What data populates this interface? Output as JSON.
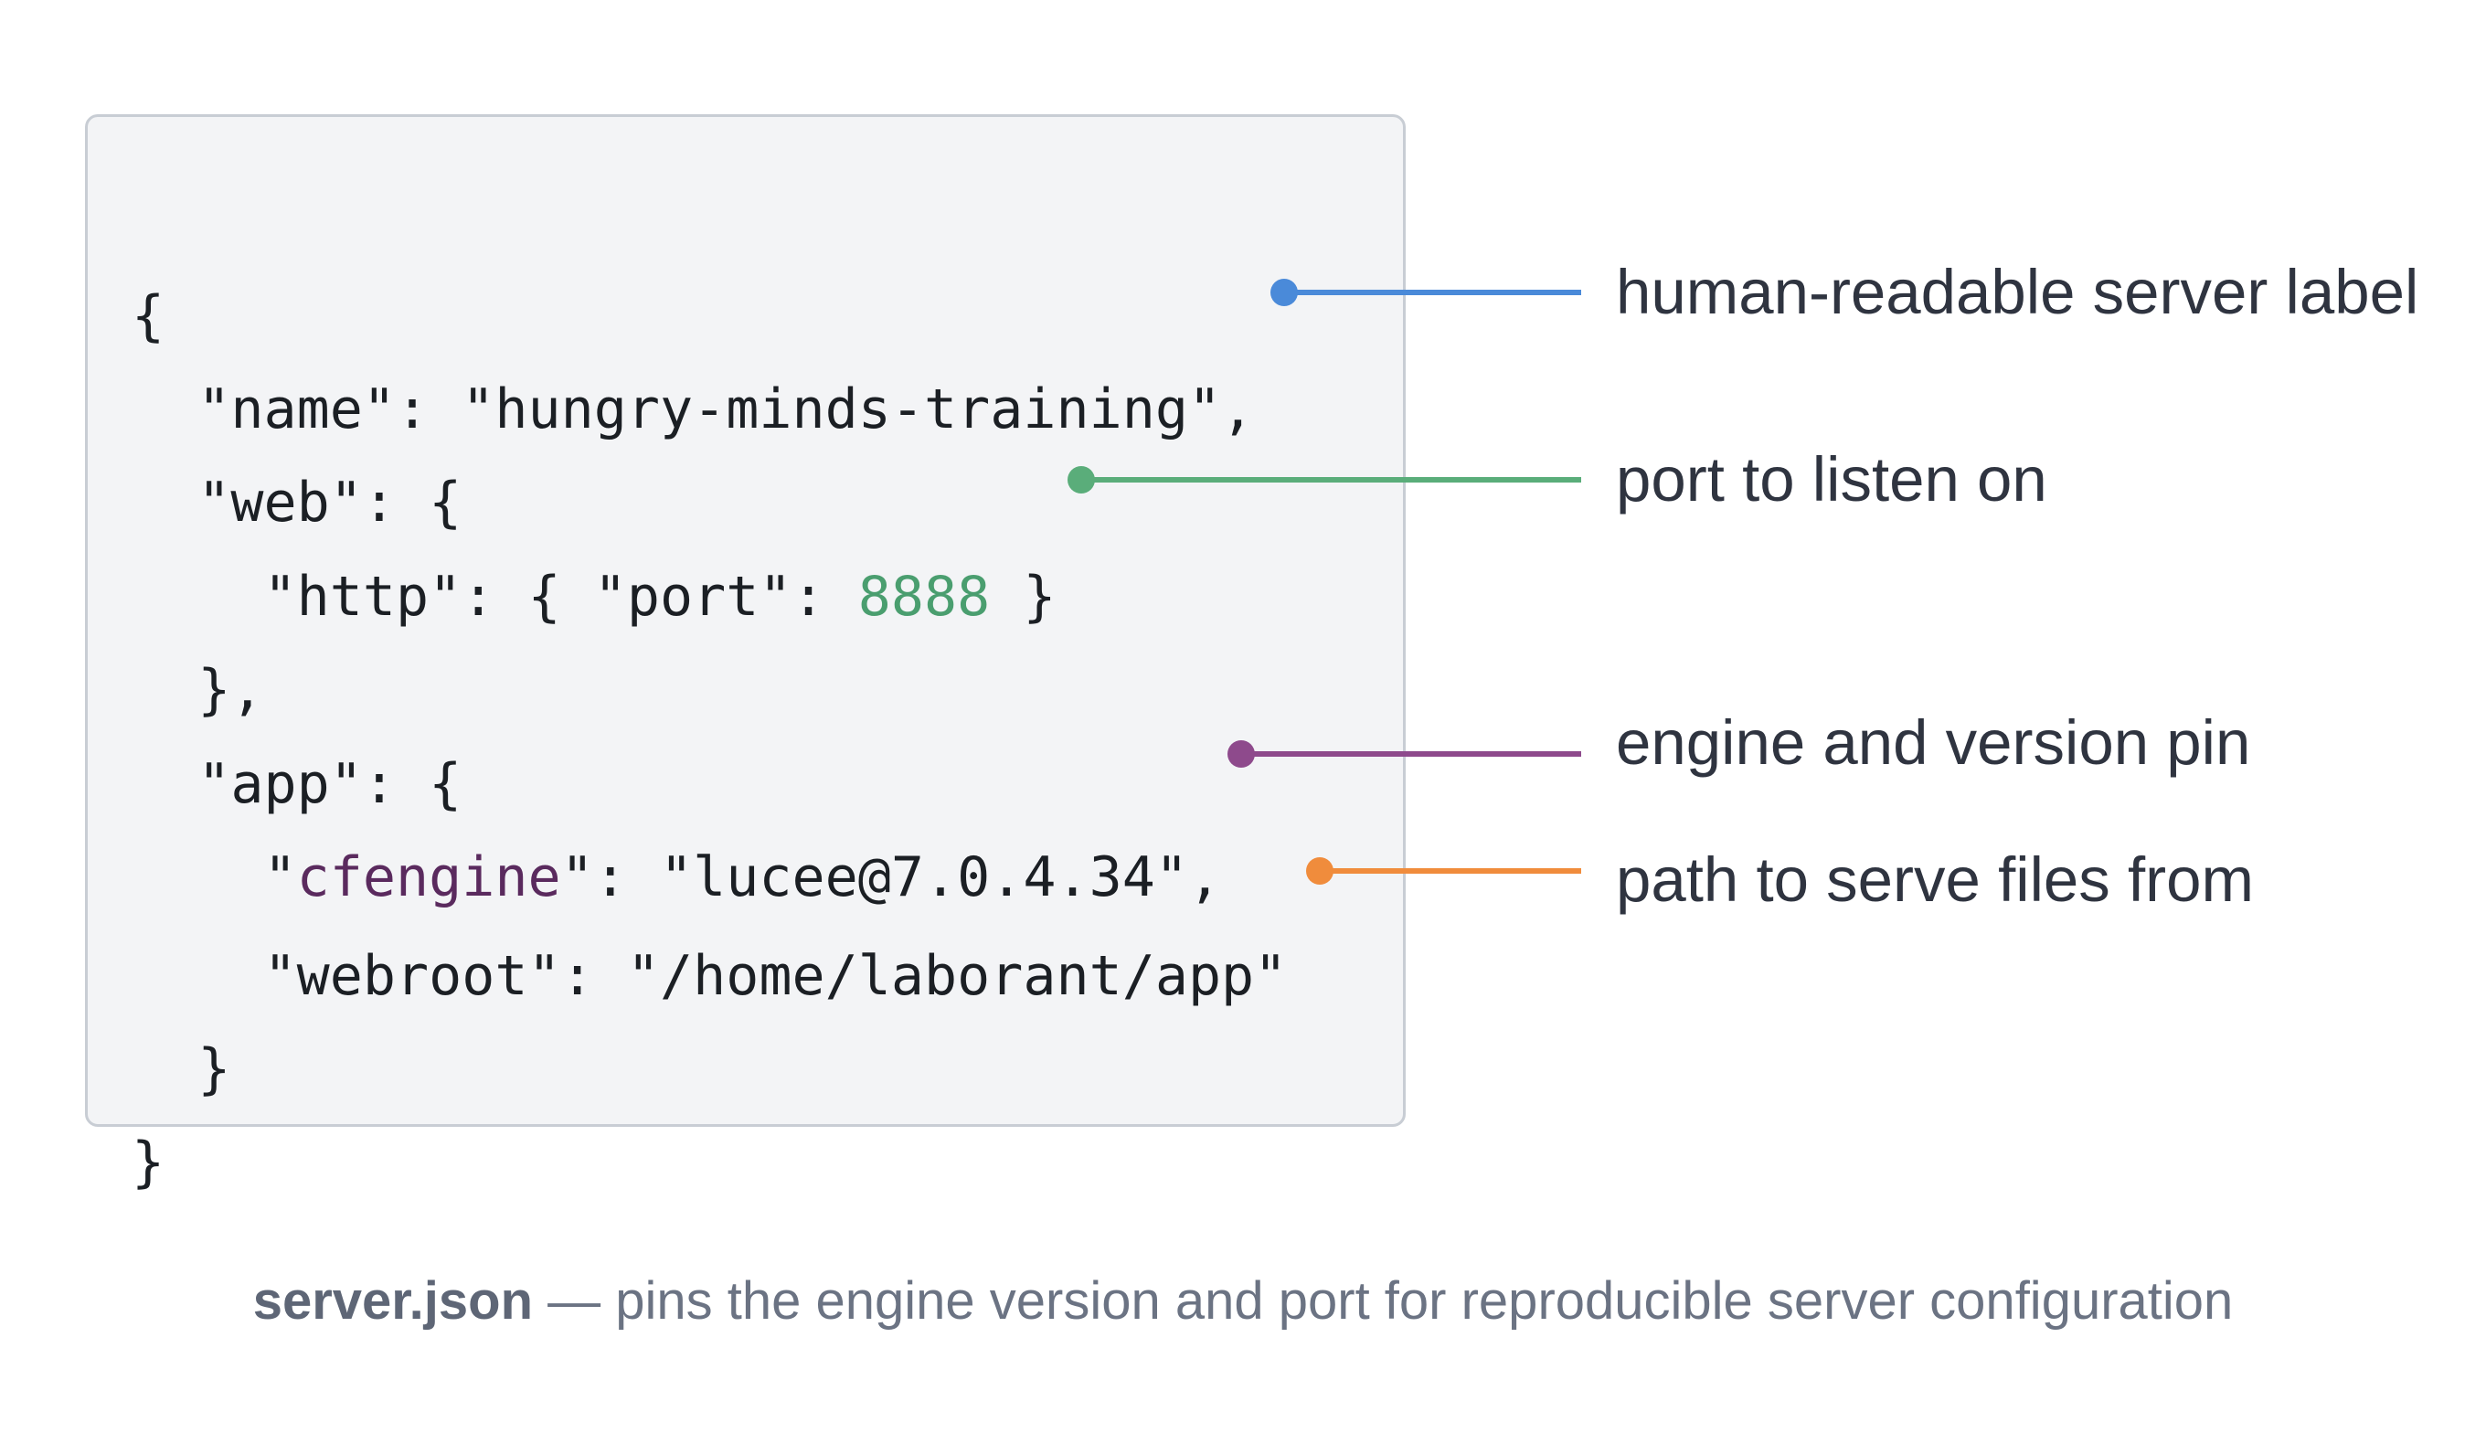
{
  "code": {
    "line_1": "{",
    "line_2": "  \"name\": \"hungry-minds-training\",",
    "line_3": "  \"web\": {",
    "line_4_pre": "    \"http\": { \"port\": ",
    "line_4_port": "8888",
    "line_4_post": " }",
    "line_5": "  },",
    "line_6": "  \"app\": {",
    "line_7_indent": "    \"",
    "line_7_key": "cfengine",
    "line_7_post": "\": \"lucee@7.0.4.34\",",
    "line_8": "    \"webroot\": \"/home/laborant/app\"",
    "line_9": "  }",
    "line_10": "}"
  },
  "callouts": [
    {
      "label": "human-readable server label",
      "color": "#4a8ad9"
    },
    {
      "label": "port to listen on",
      "color": "#5aad7a"
    },
    {
      "label": "engine and version pin",
      "color": "#8e4a8c"
    },
    {
      "label": "path to serve files from",
      "color": "#f08c3c"
    }
  ],
  "caption": {
    "file": "server.json",
    "text": " — pins the engine version and port for reproducible server configuration"
  }
}
